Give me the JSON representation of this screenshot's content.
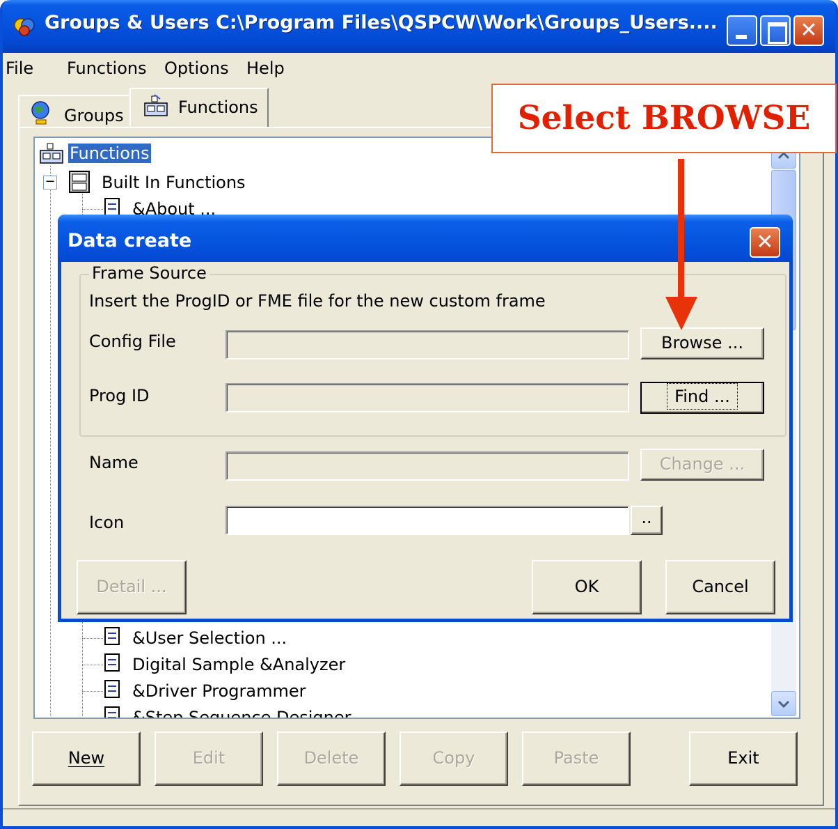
{
  "window": {
    "title": "Groups & Users C:\\Program Files\\QSPCW\\Work\\Groups_Users...."
  },
  "menu": [
    "File",
    "Functions",
    "Options",
    "Help"
  ],
  "tabs": [
    {
      "label": "Groups",
      "icon": "globe-user-icon"
    },
    {
      "label": "Functions",
      "icon": "functions-icon",
      "selected": true
    }
  ],
  "tree": {
    "root": "Functions",
    "group": "Built In Functions",
    "items_top": [
      "&About ..."
    ],
    "items_bottom": [
      "&User Selection ...",
      "Digital Sample &Analyzer",
      "&Driver Programmer",
      "&Step Sequence Designer"
    ]
  },
  "bottom_buttons": [
    {
      "label": "New",
      "mnemonic": "N",
      "enabled": true
    },
    {
      "label": "Edit",
      "mnemonic": "E",
      "enabled": false
    },
    {
      "label": "Delete",
      "mnemonic": "D",
      "enabled": false
    },
    {
      "label": "Copy",
      "mnemonic": "C",
      "enabled": false
    },
    {
      "label": "Paste",
      "mnemonic": "P",
      "enabled": false
    },
    {
      "label": "Exit",
      "mnemonic": "x",
      "enabled": true
    }
  ],
  "dialog": {
    "title": "Data create",
    "frame_legend": "Frame Source",
    "instruction": "Insert the ProgID or FME file for the new custom frame",
    "config_file_label": "Config File",
    "config_file_value": "",
    "browse_label": "Browse ...",
    "prog_id_label": "Prog ID",
    "prog_id_value": "",
    "find_label": "Find ...",
    "name_label": "Name",
    "name_value": "",
    "change_label": "Change ...",
    "icon_label": "Icon",
    "icon_value": "",
    "icon_browse_label": "..",
    "detail_label": "Detail ...",
    "ok_label": "OK",
    "cancel_label": "Cancel"
  },
  "annotation": {
    "callout": "Select BROWSE",
    "color": "#e22000"
  }
}
